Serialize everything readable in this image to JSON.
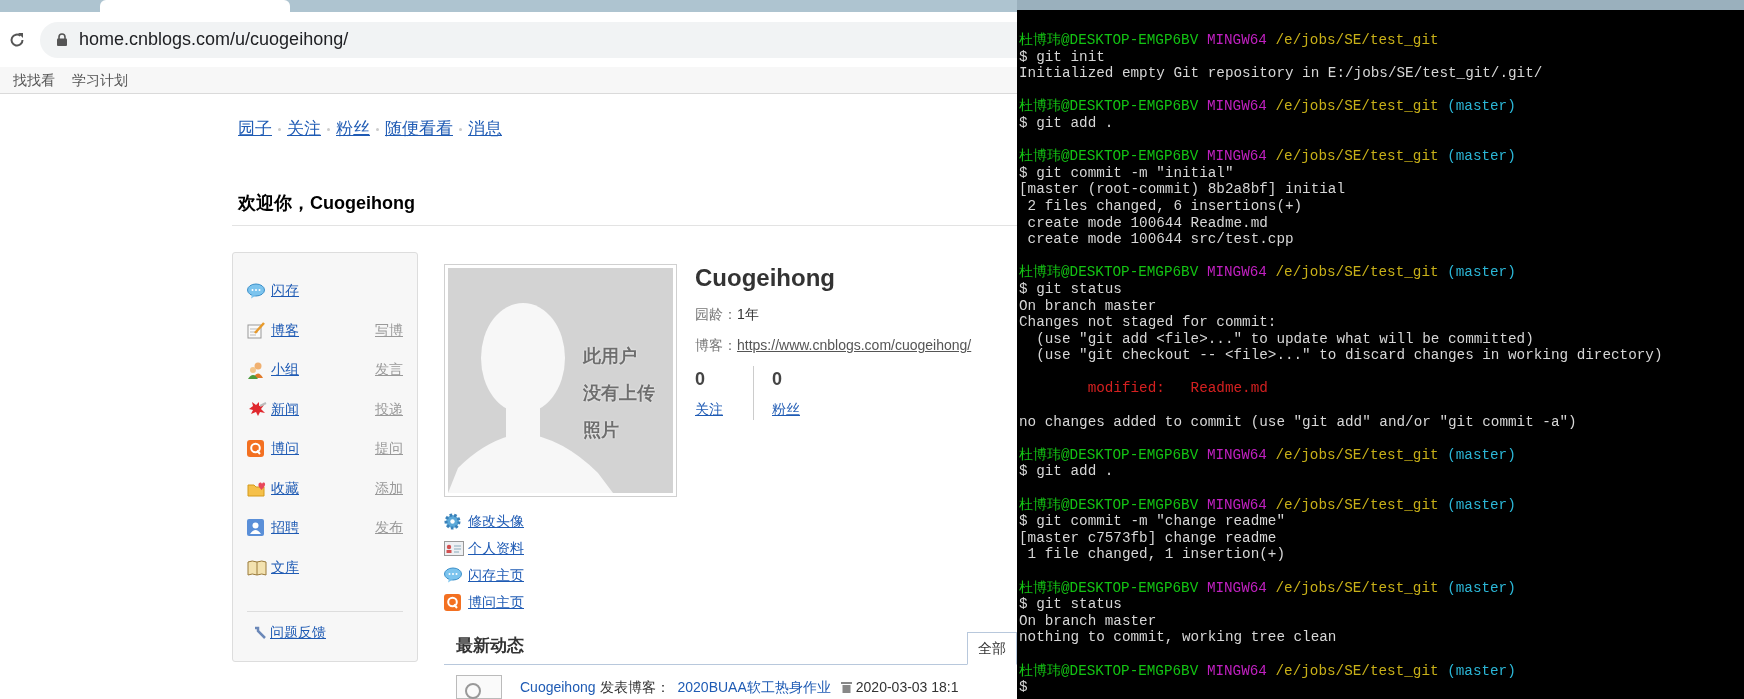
{
  "browser": {
    "url": "home.cnblogs.com/u/cuogeihong/",
    "bookmarks": [
      "找找看",
      "学习计划"
    ]
  },
  "page": {
    "nav": [
      "园子",
      "关注",
      "粉丝",
      "随便看看",
      "消息"
    ],
    "welcome": "欢迎你，Cuogeihong",
    "sidebar": {
      "items": [
        {
          "label": "闪存"
        },
        {
          "label": "博客",
          "action": "写博"
        },
        {
          "label": "小组",
          "action": "发言"
        },
        {
          "label": "新闻",
          "action": "投递"
        },
        {
          "label": "博问",
          "action": "提问"
        },
        {
          "label": "收藏",
          "action": "添加"
        },
        {
          "label": "招聘",
          "action": "发布"
        },
        {
          "label": "文库"
        }
      ],
      "feedback": "问题反馈"
    },
    "avatar_text": [
      "此用户",
      "没有上传",
      "照片"
    ],
    "profile": {
      "name": "Cuogeihong",
      "age_label": "园龄：",
      "age": "1年",
      "blog_label": "博客：",
      "blog_url": "https://www.cnblogs.com/cuogeihong/",
      "stats": [
        {
          "count": "0",
          "label": "关注"
        },
        {
          "count": "0",
          "label": "粉丝"
        }
      ]
    },
    "profile_links": [
      "修改头像",
      "个人资料",
      "闪存主页",
      "博问主页"
    ],
    "activity": {
      "title": "最新动态",
      "tabs": [
        {
          "label": "全部",
          "selected": true
        }
      ],
      "rows": [
        {
          "user": "Cuogeihong",
          "action": "发表博客：",
          "title": "2020BUAA软工热身作业",
          "time": "2020-03-03 18:1"
        }
      ]
    }
  },
  "terminal": {
    "lines": [
      {
        "kind": "prompt",
        "user": "杜博玮@DESKTOP-EMGP6BV",
        "shell": "MINGW64",
        "path": "/e/jobs/SE/test_git"
      },
      {
        "kind": "text",
        "text": "$ git init"
      },
      {
        "kind": "text",
        "text": "Initialized empty Git repository in E:/jobs/SE/test_git/.git/"
      },
      {
        "kind": "blank"
      },
      {
        "kind": "prompt",
        "user": "杜博玮@DESKTOP-EMGP6BV",
        "shell": "MINGW64",
        "path": "/e/jobs/SE/test_git",
        "branch": "(master)"
      },
      {
        "kind": "text",
        "text": "$ git add ."
      },
      {
        "kind": "blank"
      },
      {
        "kind": "prompt",
        "user": "杜博玮@DESKTOP-EMGP6BV",
        "shell": "MINGW64",
        "path": "/e/jobs/SE/test_git",
        "branch": "(master)"
      },
      {
        "kind": "text",
        "text": "$ git commit -m \"initial\""
      },
      {
        "kind": "text",
        "text": "[master (root-commit) 8b2a8bf] initial"
      },
      {
        "kind": "text",
        "text": " 2 files changed, 6 insertions(+)"
      },
      {
        "kind": "text",
        "text": " create mode 100644 Readme.md"
      },
      {
        "kind": "text",
        "text": " create mode 100644 src/test.cpp"
      },
      {
        "kind": "blank"
      },
      {
        "kind": "prompt",
        "user": "杜博玮@DESKTOP-EMGP6BV",
        "shell": "MINGW64",
        "path": "/e/jobs/SE/test_git",
        "branch": "(master)"
      },
      {
        "kind": "text",
        "text": "$ git status"
      },
      {
        "kind": "text",
        "text": "On branch master"
      },
      {
        "kind": "text",
        "text": "Changes not staged for commit:"
      },
      {
        "kind": "text",
        "text": "  (use \"git add <file>...\" to update what will be committed)"
      },
      {
        "kind": "text",
        "text": "  (use \"git checkout -- <file>...\" to discard changes in working directory)"
      },
      {
        "kind": "blank"
      },
      {
        "kind": "modified",
        "text": "        modified:   Readme.md"
      },
      {
        "kind": "blank"
      },
      {
        "kind": "text",
        "text": "no changes added to commit (use \"git add\" and/or \"git commit -a\")"
      },
      {
        "kind": "blank"
      },
      {
        "kind": "prompt",
        "user": "杜博玮@DESKTOP-EMGP6BV",
        "shell": "MINGW64",
        "path": "/e/jobs/SE/test_git",
        "branch": "(master)"
      },
      {
        "kind": "text",
        "text": "$ git add ."
      },
      {
        "kind": "blank"
      },
      {
        "kind": "prompt",
        "user": "杜博玮@DESKTOP-EMGP6BV",
        "shell": "MINGW64",
        "path": "/e/jobs/SE/test_git",
        "branch": "(master)"
      },
      {
        "kind": "text",
        "text": "$ git commit -m \"change readme\""
      },
      {
        "kind": "text",
        "text": "[master c7573fb] change readme"
      },
      {
        "kind": "text",
        "text": " 1 file changed, 1 insertion(+)"
      },
      {
        "kind": "blank"
      },
      {
        "kind": "prompt",
        "user": "杜博玮@DESKTOP-EMGP6BV",
        "shell": "MINGW64",
        "path": "/e/jobs/SE/test_git",
        "branch": "(master)"
      },
      {
        "kind": "text",
        "text": "$ git status"
      },
      {
        "kind": "text",
        "text": "On branch master"
      },
      {
        "kind": "text",
        "text": "nothing to commit, working tree clean"
      },
      {
        "kind": "blank"
      },
      {
        "kind": "prompt",
        "user": "杜博玮@DESKTOP-EMGP6BV",
        "shell": "MINGW64",
        "path": "/e/jobs/SE/test_git",
        "branch": "(master)"
      },
      {
        "kind": "text",
        "text": "$"
      }
    ]
  }
}
